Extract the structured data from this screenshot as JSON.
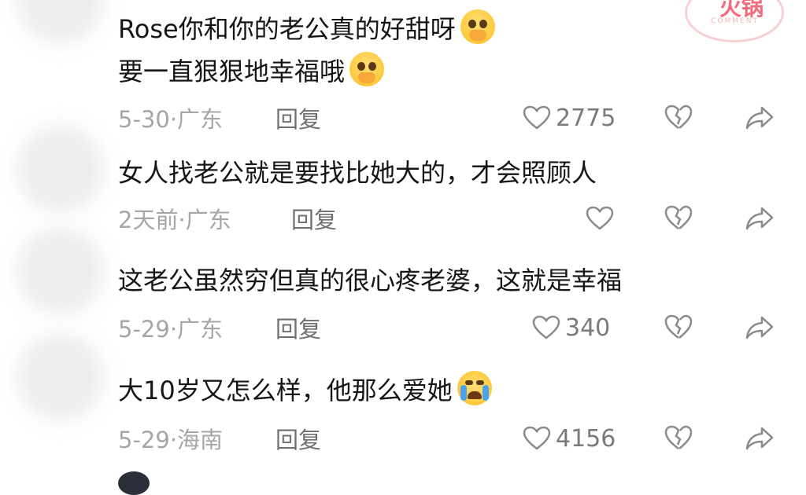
{
  "comments": [
    {
      "text_line1": "Rose你和你的老公真的好甜呀",
      "text_line2": "要一直狠狠地幸福哦",
      "meta": "5-30·广东",
      "reply": "回复",
      "likes": "2775",
      "emoji": "face-holding-back-tears"
    },
    {
      "text_line1": "女人找老公就是要找比她大的，才会照顾人",
      "meta": "2天前·广东",
      "reply": "回复",
      "likes": ""
    },
    {
      "text_line1": "这老公虽然穷但真的很心疼老婆，这就是幸福",
      "meta": "5-29·广东",
      "reply": "回复",
      "likes": "340"
    },
    {
      "text_line1": "大10岁又怎么样，他那么爱她",
      "meta": "5-29·海南",
      "reply": "回复",
      "likes": "4156",
      "emoji": "loudly-crying-face"
    }
  ],
  "colors": {
    "text": "#161616",
    "meta": "#a6a6a6",
    "reply": "#6f6f6f",
    "icon": "#8a8a8a",
    "stamp": "#f26a7b"
  },
  "stamp": {
    "label": "火锅",
    "sub": "COMMENT"
  }
}
